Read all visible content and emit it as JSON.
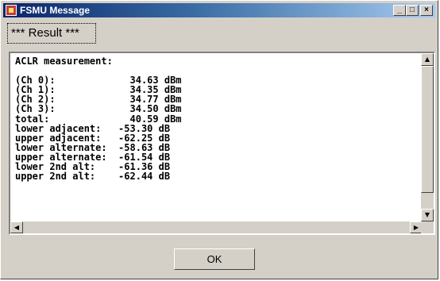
{
  "window": {
    "title": "FSMU Message"
  },
  "titlebar_buttons": [
    "_",
    "□",
    "×"
  ],
  "result_group": {
    "label": "*** Result ***"
  },
  "text_lines": [
    "ACLR measurement:",
    "",
    "(Ch 0):             34.63 dBm",
    "(Ch 1):             34.35 dBm",
    "(Ch 2):             34.77 dBm",
    "(Ch 3):             34.50 dBm",
    "total:              40.59 dBm",
    "lower adjacent:   -53.30 dB",
    "upper adjacent:   -62.25 dB",
    "lower alternate:  -58.63 dB",
    "upper alternate:  -61.54 dB",
    "lower 2nd alt:    -61.36 dB",
    "upper 2nd alt:    -62.44 dB"
  ],
  "scrollbar_arrows": {
    "up": "▲",
    "down": "▼",
    "left": "◀",
    "right": "▶"
  },
  "ok_button": {
    "label": "OK"
  }
}
